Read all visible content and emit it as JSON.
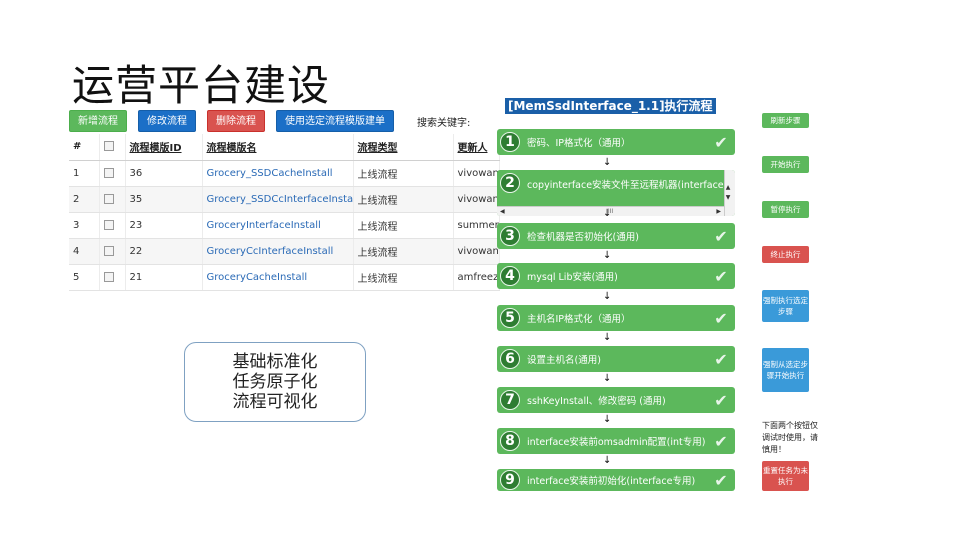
{
  "slide": {
    "title": "运营平台建设"
  },
  "toolbar": {
    "add_label": "新增流程",
    "edit_label": "修改流程",
    "delete_label": "删除流程",
    "use_template_label": "使用选定流程模版建单",
    "search_label": "搜索关键字:"
  },
  "table": {
    "headers": [
      "#",
      "",
      "流程模版ID",
      "流程模版名",
      "流程类型",
      "更新人"
    ],
    "rows": [
      {
        "index": "1",
        "id": "36",
        "name": "Grocery_SSDCacheInstall",
        "type": "上线流程",
        "updater": "vivowan"
      },
      {
        "index": "2",
        "id": "35",
        "name": "Grocery_SSDCcInterfaceInstall",
        "type": "上线流程",
        "updater": "vivowan"
      },
      {
        "index": "3",
        "id": "23",
        "name": "GroceryInterfaceInstall",
        "type": "上线流程",
        "updater": "summer"
      },
      {
        "index": "4",
        "id": "22",
        "name": "GroceryCcInterfaceInstall",
        "type": "上线流程",
        "updater": "vivowan"
      },
      {
        "index": "5",
        "id": "21",
        "name": "GroceryCacheInstall",
        "type": "上线流程",
        "updater": "amfreez"
      }
    ]
  },
  "callout": {
    "line1": "基础标准化",
    "line2": "任务原子化",
    "line3": "流程可视化"
  },
  "flow": {
    "title": "[MemSsdInterface_1.1]执行流程",
    "steps": [
      {
        "num": "1",
        "label": "密码、IP格式化（通用）",
        "checked": true
      },
      {
        "num": "2",
        "label": "copyinterface安装文件至远程机器(interface)",
        "checked": false
      },
      {
        "num": "3",
        "label": "检查机器是否初始化(通用)",
        "checked": true
      },
      {
        "num": "4",
        "label": "mysql Lib安装(通用)",
        "checked": true
      },
      {
        "num": "5",
        "label": "主机名IP格式化（通用）",
        "checked": true
      },
      {
        "num": "6",
        "label": "设置主机名(通用)",
        "checked": true
      },
      {
        "num": "7",
        "label": "sshKeyInstall、修改密码 (通用)",
        "checked": true
      },
      {
        "num": "8",
        "label": "interface安装前omsadmin配置(int专用)",
        "checked": true
      },
      {
        "num": "9",
        "label": "interface安装前初始化(interface专用)",
        "checked": true
      }
    ],
    "arrow_glyph": "↓",
    "scroll_thumb": "III"
  },
  "side": {
    "refresh_label": "刷新步骤",
    "start_label": "开始执行",
    "pause_label": "暂停执行",
    "stop_label": "终止执行",
    "force_selected_label": "强制执行选定步骤",
    "force_from_label": "强制从选定步骤开始执行",
    "note": "下面两个按钮仅调试时使用，请慎用！",
    "reset_label": "重置任务为未执行"
  },
  "colors": {
    "step_green": "#5cb85c",
    "btn_blue": "#1b6fc7",
    "btn_red": "#d9534f",
    "flow_title_bg": "#1a5fa8"
  }
}
